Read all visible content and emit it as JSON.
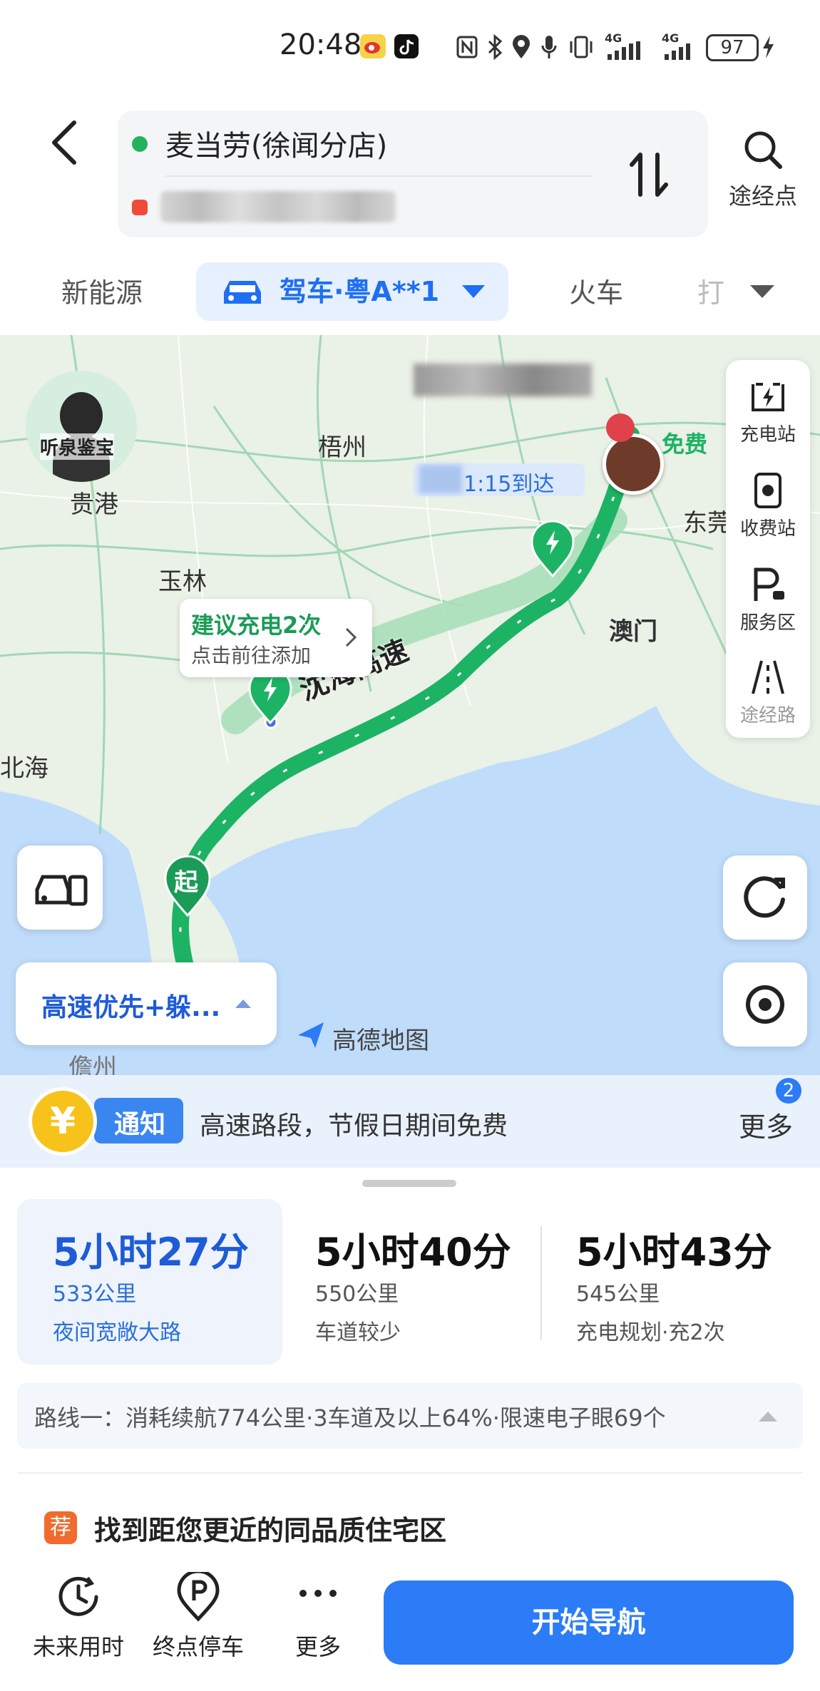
{
  "status_bar": {
    "time": "20:48",
    "battery": "97",
    "network": [
      "4G",
      "4G"
    ],
    "icons": [
      "weibo-icon",
      "tiktok-icon",
      "nfc-icon",
      "bluetooth-icon",
      "location-icon",
      "mic-icon",
      "vibrate-icon",
      "signal-icon",
      "signal-icon",
      "battery-icon",
      "charging-icon"
    ]
  },
  "header": {
    "origin": "麦当劳(徐闻分店)",
    "waypoint_label": "途经点"
  },
  "tabs": {
    "new_energy": "新能源",
    "drive": "驾车·粤A**1",
    "train": "火车",
    "partial": "打"
  },
  "map": {
    "labels": {
      "wuzhou": "梧州",
      "guigang": "贵港",
      "yulin": "玉林",
      "beihai": "北海",
      "macau": "澳门",
      "dongguan": "东莞",
      "danzhou": "儋州",
      "free": "免费",
      "arrive": "1:15到达"
    },
    "road_name": "沈海高速",
    "suggest_title": "建议充电2次",
    "suggest_sub": "点击前往添加",
    "start_marker": "起",
    "brand": "高德地图",
    "avatar_caption": "听泉鉴宝",
    "route_preference": "高速优先+躲...",
    "side_tools": [
      "充电站",
      "收费站",
      "服务区",
      "途经路"
    ]
  },
  "notice": {
    "tag": "通知",
    "text": "高速路段，节假日期间免费",
    "more": "更多",
    "badge": "2",
    "coin": "¥"
  },
  "routes": [
    {
      "time": "5小时27分",
      "distance": "533公里",
      "tag": "夜间宽敞大路"
    },
    {
      "time": "5小时40分",
      "distance": "550公里",
      "tag": "车道较少"
    },
    {
      "time": "5小时43分",
      "distance": "545公里",
      "tag": "充电规划·充2次"
    }
  ],
  "route_detail": "路线一：消耗续航774公里·3车道及以上64%·限速电子眼69个",
  "recommendation": {
    "badge": "荐",
    "text": "找到距您更近的同品质住宅区"
  },
  "bottom_bar": {
    "future_time": "未来用时",
    "end_parking": "终点停车",
    "more": "更多",
    "start_navigation": "开始导航"
  },
  "colors": {
    "accent": "#2b7cf6",
    "route_green": "#1db364",
    "route_alt_green": "#8fd6a8",
    "notice_bg": "#e9f1fd",
    "coin_yellow": "#f7c21a"
  }
}
